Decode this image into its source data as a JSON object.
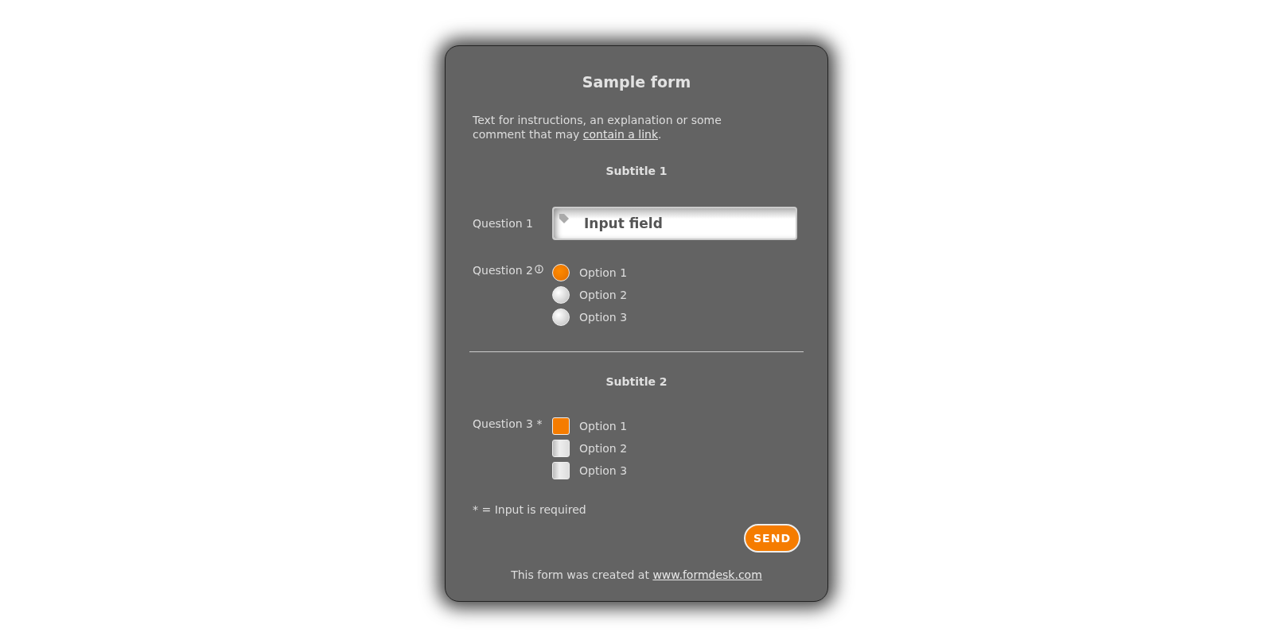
{
  "title": "Sample form",
  "intro": {
    "before": "Text for instructions, an explanation or some comment that may ",
    "link": "contain a link",
    "after": "."
  },
  "sections": [
    {
      "subtitle": "Subtitle 1",
      "questions": [
        {
          "kind": "text",
          "label": "Question 1",
          "value": "Input field"
        },
        {
          "kind": "radio",
          "label": "Question 2",
          "info": true,
          "options": [
            {
              "label": "Option 1",
              "selected": true
            },
            {
              "label": "Option 2",
              "selected": false
            },
            {
              "label": "Option 3",
              "selected": false
            }
          ]
        }
      ]
    },
    {
      "subtitle": "Subtitle 2",
      "questions": [
        {
          "kind": "checkbox",
          "label": "Question 3 *",
          "info": false,
          "options": [
            {
              "label": "Option 1",
              "checked": true
            },
            {
              "label": "Option 2",
              "checked": false
            },
            {
              "label": "Option 3",
              "checked": false
            }
          ]
        }
      ]
    }
  ],
  "required_note": "* = Input is required",
  "submit": "SEND",
  "footer": {
    "before": "This form was created at ",
    "link": "www.formdesk.com"
  }
}
